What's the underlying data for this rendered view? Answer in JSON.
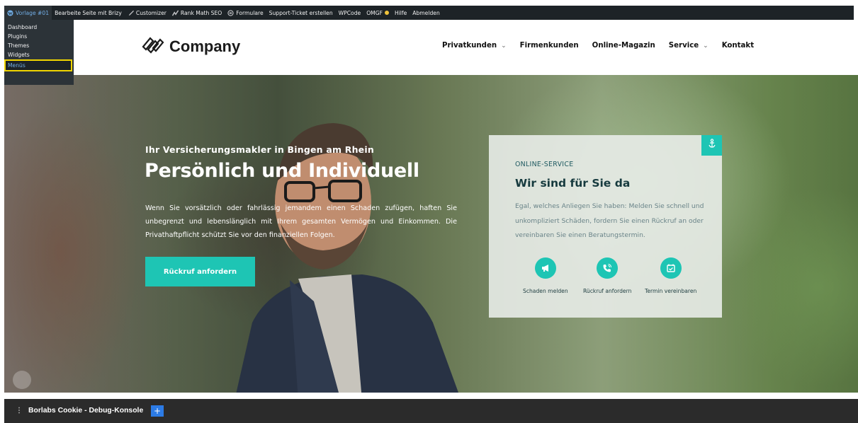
{
  "admin_bar": {
    "items": [
      {
        "label": "Vorlage #01",
        "icon": "wordpress-icon"
      },
      {
        "label": "Bearbeite Seite mit Brizy"
      },
      {
        "label": "Customizer",
        "icon": "brush-icon"
      },
      {
        "label": "Rank Math SEO",
        "icon": "rank-math-icon"
      },
      {
        "label": "Formulare",
        "icon": "forms-icon"
      },
      {
        "label": "Support-Ticket erstellen"
      },
      {
        "label": "WPCode"
      },
      {
        "label": "OMGF"
      },
      {
        "label": "Hilfe"
      },
      {
        "label": "Abmelden"
      }
    ],
    "dropdown": [
      "Dashboard",
      "Plugins",
      "Themes",
      "Widgets",
      "Menüs"
    ]
  },
  "header": {
    "logo_text": "Company",
    "nav": [
      {
        "label": "Privatkunden",
        "has_dropdown": true
      },
      {
        "label": "Firmenkunden",
        "has_dropdown": false
      },
      {
        "label": "Online-Magazin",
        "has_dropdown": false
      },
      {
        "label": "Service",
        "has_dropdown": true
      },
      {
        "label": "Kontakt",
        "has_dropdown": false
      }
    ]
  },
  "hero": {
    "subtitle": "Ihr Versicherungsmakler in Bingen am Rhein",
    "title": "Persönlich und Individuell",
    "text": "Wenn Sie vorsätzlich oder fahrlässig jemandem einen Schaden zufügen, haften Sie unbegrenzt und lebenslänglich mit Ihrem gesamten Vermögen und Einkommen. Die Privathaftpflicht schützt Sie vor den finanziellen Folgen.",
    "cta_label": "Rückruf anfordern"
  },
  "service_card": {
    "kicker": "ONLINE-SERVICE",
    "title": "Wir sind für Sie da",
    "text": "Egal, welches Anliegen Sie haben: Melden Sie schnell und unkompliziert Schäden, fordern Sie einen Rückruf an oder vereinbaren Sie einen Beratungstermin.",
    "actions": [
      {
        "label": "Schaden melden",
        "icon": "megaphone-icon"
      },
      {
        "label": "Rückruf anfordern",
        "icon": "phone-icon"
      },
      {
        "label": "Termin vereinbaren",
        "icon": "calendar-icon"
      }
    ]
  },
  "debug_bar": {
    "title": "Borlabs Cookie - Debug-Konsole",
    "plus_label": "+"
  },
  "colors": {
    "accent": "#1ec5b4",
    "admin_bar": "#1d2327",
    "highlight_border": "#f0d500",
    "debug_bar": "#2b2b2b",
    "debug_plus": "#2c7be5"
  }
}
